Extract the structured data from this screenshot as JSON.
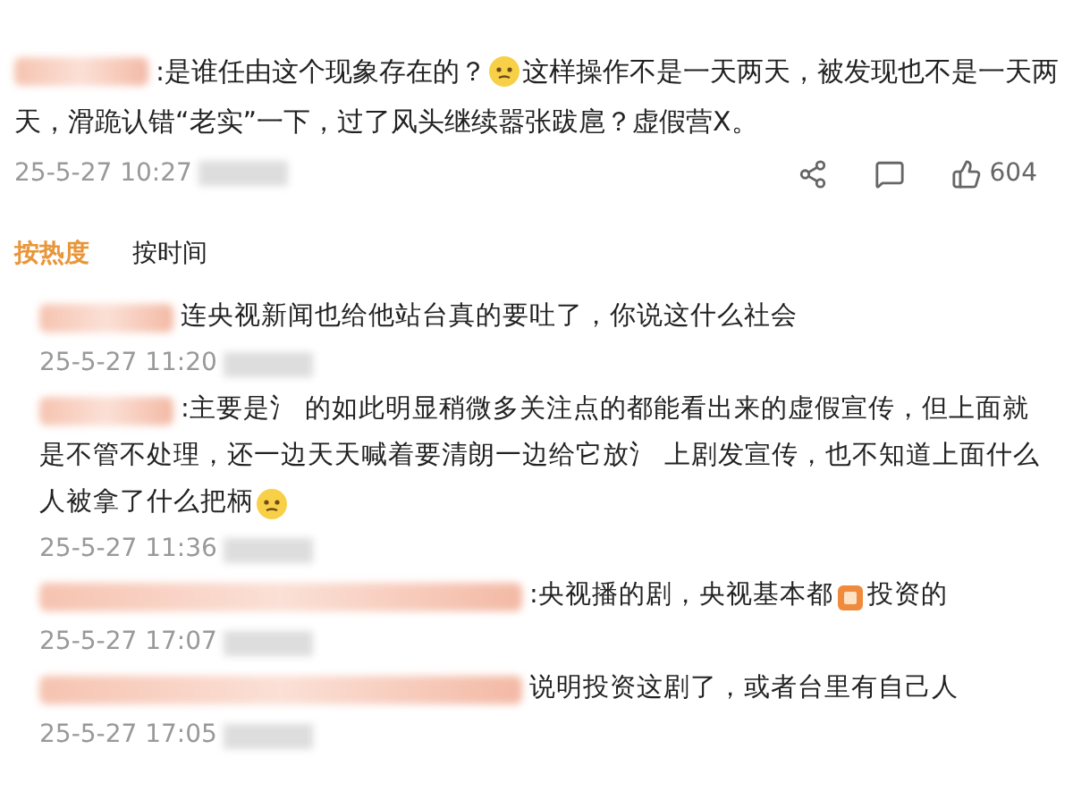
{
  "post": {
    "lines": [
      [
        {
          "kind": "name"
        },
        {
          "kind": "text",
          "text": ":是谁任由这个现象存在的？"
        },
        {
          "kind": "emoji"
        },
        {
          "kind": "text",
          "text": "这样操作不是一天两天，被发现也不是一天两"
        }
      ],
      [
        {
          "kind": "text",
          "text": "天，滑跪认错“老实”一下，过了风头继续嚣张跋扈？虚假营X。"
        }
      ]
    ],
    "time": "25-5-27 10:27",
    "likes": "604"
  },
  "sort_tabs": [
    {
      "label": "按热度",
      "selected": true
    },
    {
      "label": "按时间",
      "selected": false
    }
  ],
  "replies": [
    {
      "lines": [
        [
          {
            "kind": "name"
          },
          {
            "kind": "text",
            "text": "连央视新闻也给他站台真的要吐了，你说这什么社会"
          }
        ]
      ],
      "time": "25-5-27 11:20"
    },
    {
      "lines": [
        [
          {
            "kind": "name"
          },
          {
            "kind": "text",
            "text": ":主要是氵 的如此明显稍微多关注点的都能看出来的虚假宣传，但上面就"
          }
        ],
        [
          {
            "kind": "text",
            "text": "是不管不处理，还一边天天喊着要清朗一边给它放氵 上剧发宣传，也不知道上面什么"
          }
        ],
        [
          {
            "kind": "text",
            "text": "人被拿了什么把柄"
          },
          {
            "kind": "emoji"
          }
        ]
      ],
      "time": "25-5-27 11:36"
    },
    {
      "lines": [
        [
          {
            "kind": "longname"
          },
          {
            "kind": "text",
            "text": ":央视播的剧，央视基本都"
          },
          {
            "kind": "badge"
          },
          {
            "kind": "text",
            "text": "投资的"
          }
        ]
      ],
      "time": "25-5-27 17:07"
    },
    {
      "lines": [
        [
          {
            "kind": "longname"
          },
          {
            "kind": "text",
            "text": "说明投资这剧了，或者台里有自己人"
          }
        ]
      ],
      "time": "25-5-27 17:05"
    }
  ]
}
